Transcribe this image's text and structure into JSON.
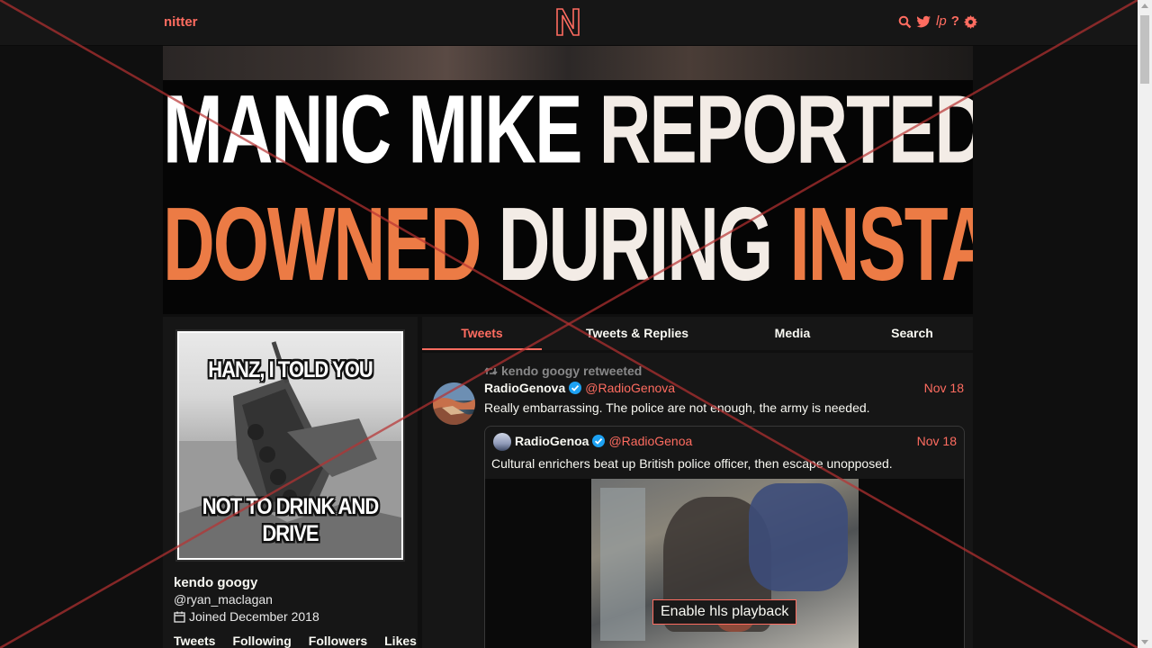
{
  "nav": {
    "brand": "nitter",
    "icons": [
      "search-icon",
      "rss-icon",
      "lp-icon",
      "help-icon",
      "gear-icon"
    ],
    "lp_text": "lp",
    "help_text": "?"
  },
  "banner": {
    "line1": [
      "MANIC",
      "MIKE",
      "REPORTEDLY"
    ],
    "line2": [
      "DOWNED",
      "DURING",
      "INSTAKILL"
    ]
  },
  "profile": {
    "avatar_caption_top": "HANZ, I TOLD YOU",
    "avatar_caption_bottom": "NOT TO DRINK AND DRIVE",
    "fullname": "kendo googy",
    "username": "@ryan_maclagan",
    "joined": "Joined December 2018",
    "stats": [
      "Tweets",
      "Following",
      "Followers",
      "Likes"
    ]
  },
  "tabs": [
    "Tweets",
    "Tweets & Replies",
    "Media",
    "Search"
  ],
  "tweet": {
    "retweet_header": "kendo googy retweeted",
    "fullname": "RadioGenova",
    "username": "@RadioGenova",
    "date": "Nov 18",
    "text": "Really embarrassing. The police are not enough, the army is needed.",
    "quote": {
      "fullname": "RadioGenoa",
      "username": "@RadioGenoa",
      "date": "Nov 18",
      "text": "Cultural enrichers beat up British police officer, then escape unopposed.",
      "video_button": "Enable hls playback"
    }
  },
  "colors": {
    "accent": "#ff6c60",
    "background": "#0f0f0f",
    "panel": "#161616",
    "verified": "#1da1f2"
  }
}
